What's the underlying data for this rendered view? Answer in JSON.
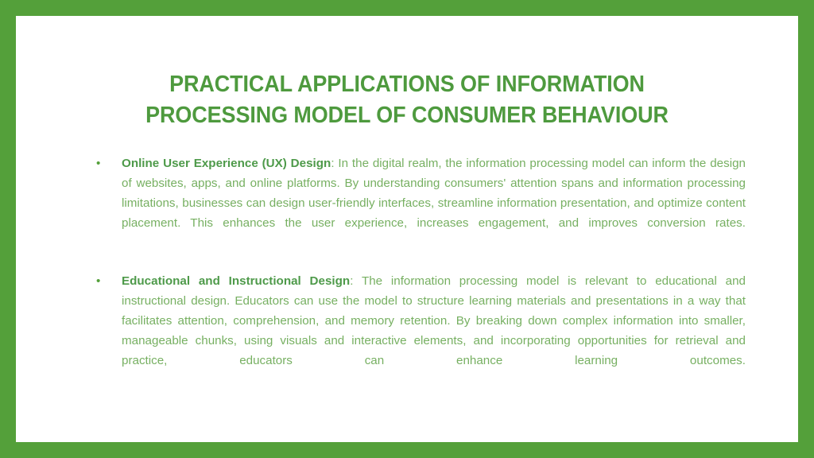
{
  "slide": {
    "frame_color": "#54A03A",
    "background_color": "#ffffff",
    "title_color": "#4E9A3E",
    "lead_color": "#4E9A4A",
    "body_color": "#77B062",
    "title": "PRACTICAL APPLICATIONS OF INFORMATION\nPROCESSING MODEL OF CONSUMER BEHAVIOUR",
    "title_line_1": "PRACTICAL APPLICATIONS OF INFORMATION",
    "title_line_2": "PROCESSING MODEL OF CONSUMER BEHAVIOUR",
    "bullets": [
      {
        "marker": "•",
        "lead": "Online User Experience (UX) Design",
        "separator": ": ",
        "text": "In the digital realm, the information processing model can inform the design of websites, apps, and online platforms. By understanding consumers' attention spans and information processing limitations, businesses can design user-friendly interfaces, streamline information presentation, and optimize content placement. This enhances the user experience, increases engagement, and improves conversion rates."
      },
      {
        "marker": "•",
        "lead": "Educational and Instructional Design",
        "separator": ": ",
        "text": "The information processing model is relevant to educational and instructional design. Educators can use the model to structure learning materials and presentations in a way that facilitates attention, comprehension, and memory retention. By breaking down complex information into smaller, manageable chunks, using visuals and interactive elements, and incorporating opportunities for retrieval and practice, educators can enhance learning outcomes."
      }
    ]
  }
}
